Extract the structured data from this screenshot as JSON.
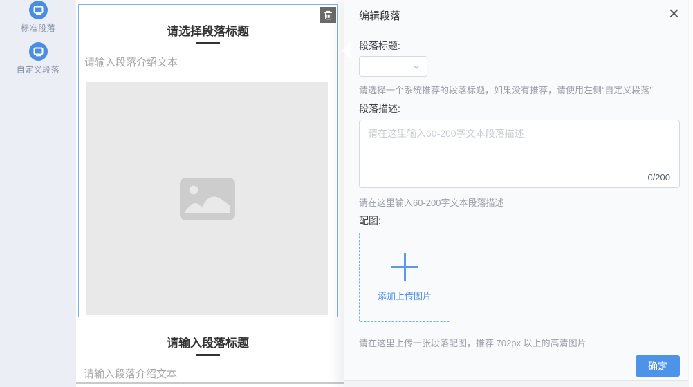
{
  "colors": {
    "accent": "#4a90e2",
    "selection_border": "#7fb2e8",
    "sidebar_bg": "#ebeef5",
    "panel_bg": "#f9fafb",
    "image_placeholder_bg": "#e9e9e9"
  },
  "icons": {
    "sidebar_item": "monitor-icon",
    "delete": "trash-icon",
    "image_placeholder": "image-icon",
    "select": "chevron-down-icon",
    "upload": "plus-icon",
    "close": "close-icon"
  },
  "sidebar": {
    "items": [
      {
        "label": "标准段落"
      },
      {
        "label": "自定义段落"
      }
    ]
  },
  "preview": {
    "selected_card": {
      "title": "请选择段落标题",
      "intro": "请输入段落介绍文本"
    },
    "next_card": {
      "title": "请输入段落标题",
      "intro": "请输入段落介绍文本"
    }
  },
  "panel": {
    "title": "编辑段落",
    "close_glyph": "×",
    "title_field": {
      "label": "段落标题:",
      "hint": "请选择一个系统推荐的段落标题，如果没有推荐，请使用左侧“自定义段落”"
    },
    "desc_field": {
      "label": "段落描述:",
      "placeholder": "请在这里输入60-200字文本段落描述",
      "counter": "0/200",
      "hint": "请在这里输入60-200字文本段落描述"
    },
    "image_field": {
      "label": "配图:",
      "upload_label": "添加上传图片",
      "hint": "请在这里上传一张段落配图，推荐 702px 以上的高清图片"
    },
    "confirm_label": "确定"
  }
}
